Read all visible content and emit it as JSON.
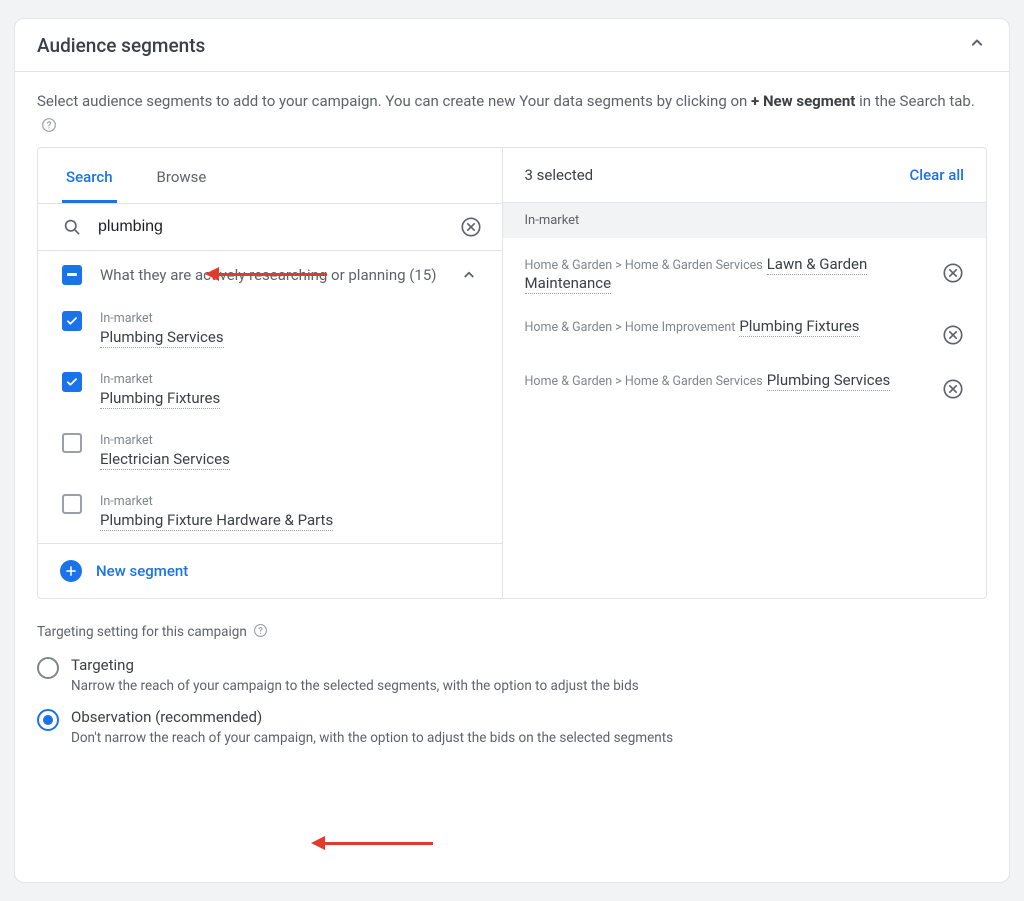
{
  "header": {
    "title": "Audience segments"
  },
  "intro": {
    "prefix": "Select audience segments to add to your campaign. You can create new Your data segments by clicking on ",
    "bold": "+ New segment",
    "suffix": " in the Search tab."
  },
  "tabs": [
    {
      "label": "Search",
      "active": true
    },
    {
      "label": "Browse",
      "active": false
    }
  ],
  "search": {
    "value": "plumbing"
  },
  "group": {
    "label": "What they are actively researching or planning (15)"
  },
  "results": [
    {
      "eyebrow": "In-market",
      "name": "Plumbing Services",
      "checked": true
    },
    {
      "eyebrow": "In-market",
      "name": "Plumbing Fixtures",
      "checked": true
    },
    {
      "eyebrow": "In-market",
      "name": "Electrician Services",
      "checked": false
    },
    {
      "eyebrow": "In-market",
      "name": "Plumbing Fixture Hardware & Parts",
      "checked": false
    }
  ],
  "newSegmentLabel": "New segment",
  "selected": {
    "countLabel": "3 selected",
    "clearLabel": "Clear all",
    "groupLabel": "In-market",
    "items": [
      {
        "path": "Home & Garden > Home & Garden Services",
        "name": "Lawn & Garden Maintenance"
      },
      {
        "path": "Home & Garden > Home Improvement",
        "name": "Plumbing Fixtures"
      },
      {
        "path": "Home & Garden > Home & Garden Services",
        "name": "Plumbing Services"
      }
    ]
  },
  "targeting": {
    "heading": "Targeting setting for this campaign",
    "options": [
      {
        "title": "Targeting",
        "desc": "Narrow the reach of your campaign to the selected segments, with the option to adjust the bids",
        "selected": false
      },
      {
        "title": "Observation (recommended)",
        "desc": "Don't narrow the reach of your campaign, with the option to adjust the bids on the selected segments",
        "selected": true
      }
    ]
  }
}
